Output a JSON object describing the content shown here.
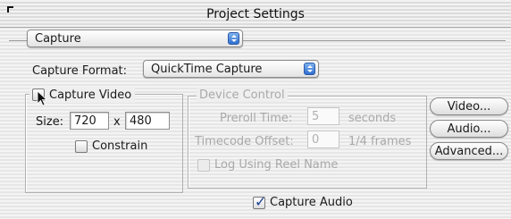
{
  "window": {
    "title": "Project Settings"
  },
  "category_popup": {
    "value": "Capture"
  },
  "capture_format": {
    "label": "Capture Format:",
    "value": "QuickTime Capture"
  },
  "capture_video": {
    "checkbox_label": "Capture Video",
    "checked": false,
    "size_label": "Size:",
    "width": "720",
    "x_label": "x",
    "height": "480",
    "constrain_label": "Constrain"
  },
  "device_control": {
    "title": "Device Control",
    "preroll_label": "Preroll Time:",
    "preroll_value": "5",
    "preroll_unit": "seconds",
    "timecode_label": "Timecode Offset:",
    "timecode_value": "0",
    "timecode_unit": "1/4 frames",
    "reel_label": "Log Using Reel Name"
  },
  "buttons": {
    "video": "Video...",
    "audio": "Audio...",
    "advanced": "Advanced..."
  },
  "capture_audio": {
    "label": "Capture Audio",
    "checked": true
  }
}
